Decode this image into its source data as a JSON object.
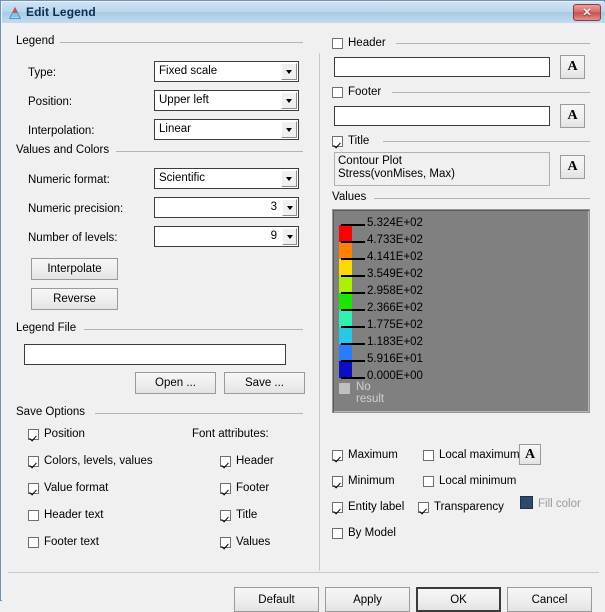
{
  "window": {
    "title": "Edit Legend",
    "icon": "legend-app-icon",
    "close_label": "✕"
  },
  "legend_group": {
    "title": "Legend",
    "type_label": "Type:",
    "type_value": "Fixed scale",
    "position_label": "Position:",
    "position_value": "Upper left",
    "interpolation_label": "Interpolation:",
    "interpolation_value": "Linear"
  },
  "values_colors_group": {
    "title": "Values and Colors",
    "numeric_format_label": "Numeric format:",
    "numeric_format_value": "Scientific",
    "numeric_precision_label": "Numeric precision:",
    "numeric_precision_value": "3",
    "number_of_levels_label": "Number of levels:",
    "number_of_levels_value": "9",
    "interpolate_button": "Interpolate",
    "reverse_button": "Reverse"
  },
  "legend_file_group": {
    "title": "Legend File",
    "path_value": "",
    "path_placeholder": "",
    "open_button": "Open ...",
    "save_button": "Save ..."
  },
  "save_options_group": {
    "title": "Save Options",
    "font_attributes_label": "Font attributes:",
    "left_items": [
      {
        "label": "Position",
        "checked": true
      },
      {
        "label": "Colors, levels, values",
        "checked": true
      },
      {
        "label": "Value format",
        "checked": true
      },
      {
        "label": "Header text",
        "checked": false
      },
      {
        "label": "Footer text",
        "checked": false
      }
    ],
    "right_items": [
      {
        "label": "Header",
        "checked": true
      },
      {
        "label": "Footer",
        "checked": true
      },
      {
        "label": "Title",
        "checked": true
      },
      {
        "label": "Values",
        "checked": true
      }
    ]
  },
  "header_group": {
    "title": "Header",
    "checked": false,
    "text_value": "",
    "font_button": "A"
  },
  "footer_group": {
    "title": "Footer",
    "checked": false,
    "text_value": "",
    "font_button": "A"
  },
  "title_group": {
    "title": "Title",
    "checked": true,
    "line1": "Contour Plot",
    "line2": "Stress(vonMises, Max)",
    "font_button": "A"
  },
  "values_group": {
    "title": "Values",
    "panel_background": "#808080",
    "entries": [
      {
        "value": "5.324E+02",
        "color": "#ff0000"
      },
      {
        "value": "4.733E+02",
        "color": "#ff8000"
      },
      {
        "value": "4.141E+02",
        "color": "#ffd900"
      },
      {
        "value": "3.549E+02",
        "color": "#aaf000"
      },
      {
        "value": "2.958E+02",
        "color": "#18e800"
      },
      {
        "value": "2.366E+02",
        "color": "#2ff0b0"
      },
      {
        "value": "1.775E+02",
        "color": "#22c9e8"
      },
      {
        "value": "1.183E+02",
        "color": "#2a7dfa"
      },
      {
        "value": "5.916E+01",
        "color": "#0d0dc8"
      },
      {
        "value": "0.000E+00",
        "color": null
      }
    ],
    "no_result_label": "No result",
    "no_result_color": "#c0c0c0"
  },
  "options": {
    "maximum": {
      "label": "Maximum",
      "checked": true
    },
    "minimum": {
      "label": "Minimum",
      "checked": true
    },
    "entity_label": {
      "label": "Entity label",
      "checked": true
    },
    "by_model": {
      "label": "By Model",
      "checked": false
    },
    "local_maximum": {
      "label": "Local maximum",
      "checked": false
    },
    "local_minimum": {
      "label": "Local minimum",
      "checked": false
    },
    "transparency": {
      "label": "Transparency",
      "checked": true
    },
    "fill_color": {
      "label": "Fill color",
      "color": "#2e4a6b"
    },
    "font_button": "A"
  },
  "footer_buttons": {
    "default": "Default",
    "apply": "Apply",
    "ok": "OK",
    "cancel": "Cancel"
  }
}
